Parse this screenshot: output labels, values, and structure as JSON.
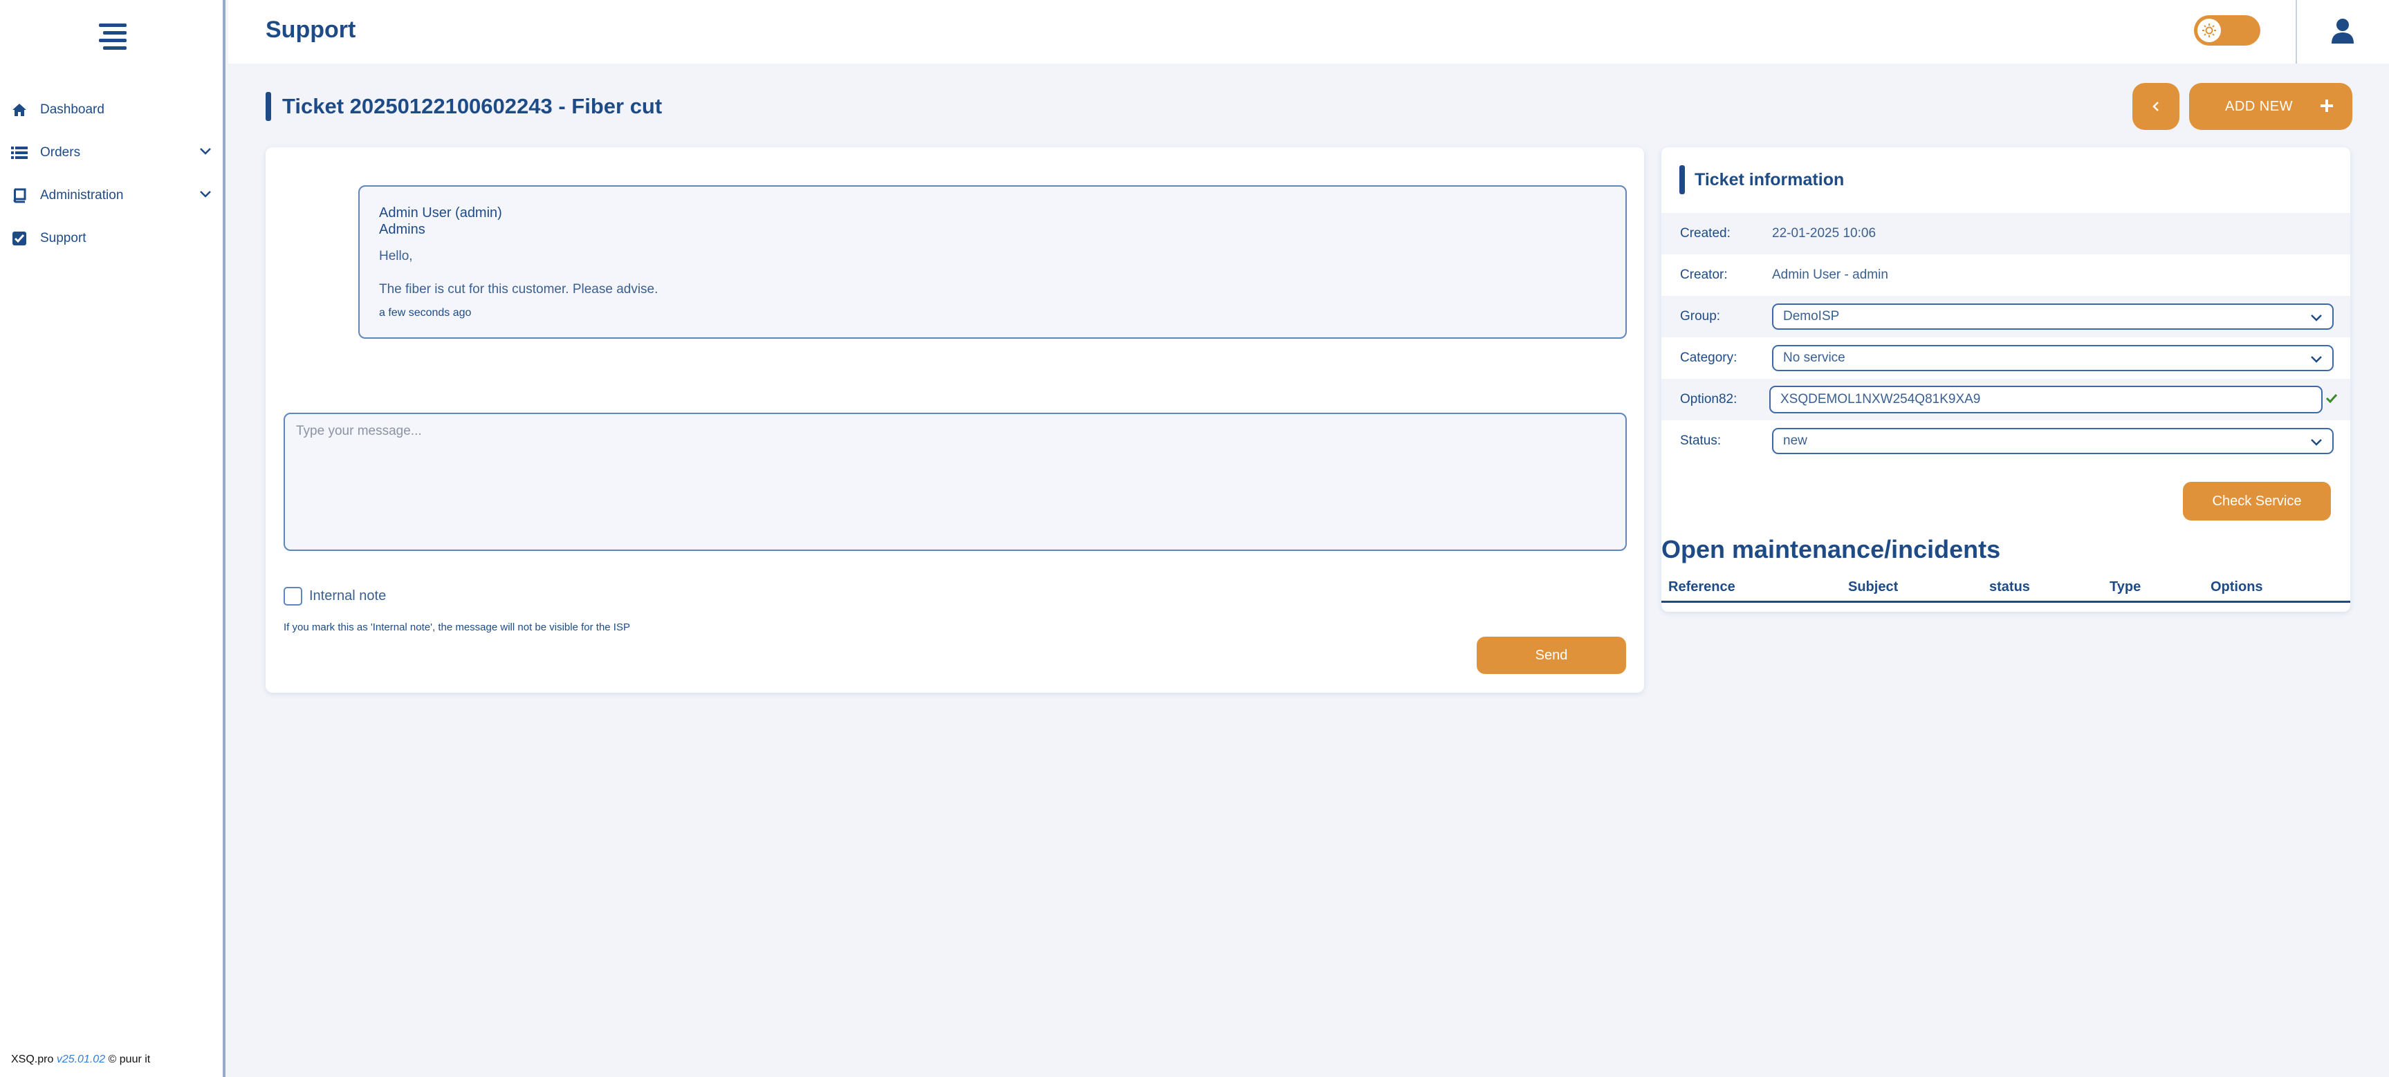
{
  "sidebar": {
    "items": [
      {
        "label": "Dashboard",
        "icon": "home-icon"
      },
      {
        "label": "Orders",
        "icon": "list-icon",
        "expandable": true
      },
      {
        "label": "Administration",
        "icon": "book-icon",
        "expandable": true
      },
      {
        "label": "Support",
        "icon": "checkbox-icon"
      }
    ],
    "footer": {
      "brand": "XSQ.pro",
      "version": "v25.01.02",
      "copyright": "© puur it"
    }
  },
  "header": {
    "title": "Support"
  },
  "ticket": {
    "title": "Ticket 20250122100602243 - Fiber cut",
    "add_new_label": "ADD NEW"
  },
  "conversation": {
    "message": {
      "author": "Admin User (admin)",
      "group": "Admins",
      "greeting": "Hello,",
      "body": "The fiber is cut for this customer. Please advise.",
      "time": "a few seconds ago"
    },
    "compose_placeholder": "Type your message...",
    "internal_note_label": "Internal note",
    "internal_note_hint": "If you mark this as 'Internal note', the message will not be visible for the ISP",
    "send_label": "Send"
  },
  "ticket_info": {
    "title": "Ticket information",
    "created_label": "Created:",
    "created_value": "22-01-2025 10:06",
    "creator_label": "Creator:",
    "creator_value": "Admin User - admin",
    "group_label": "Group:",
    "group_value": "DemoISP",
    "category_label": "Category:",
    "category_value": "No service",
    "option82_label": "Option82:",
    "option82_value": "XSQDEMOL1NXW254Q81K9XA9",
    "status_label": "Status:",
    "status_value": "new",
    "check_service_label": "Check Service"
  },
  "maintenance": {
    "title": "Open maintenance/incidents",
    "columns": [
      "Reference",
      "Subject",
      "status",
      "Type",
      "Options"
    ]
  },
  "colors": {
    "accent": "#e0923a",
    "primary": "#1e4b86",
    "background": "#f2f4fa"
  }
}
